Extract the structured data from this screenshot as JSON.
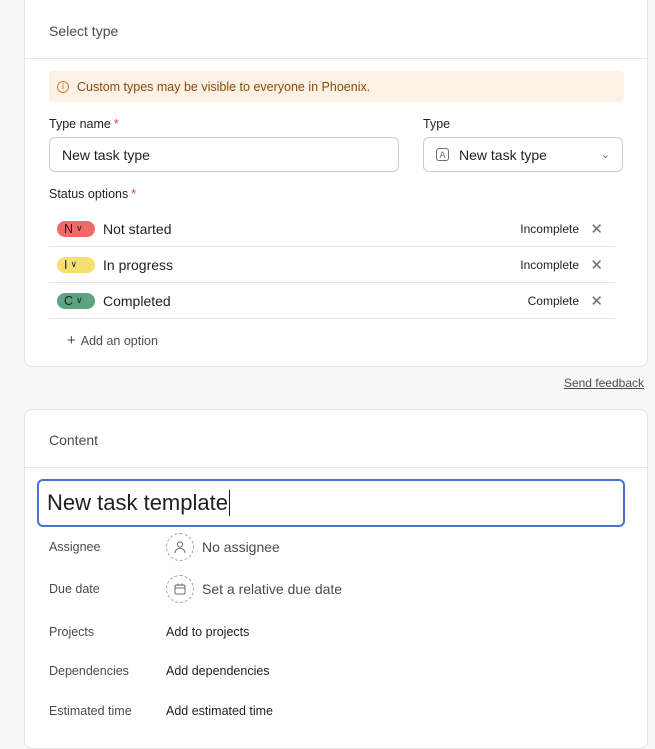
{
  "type_card": {
    "title": "Select type",
    "banner_text": "Custom types may be visible to everyone in Phoenix.",
    "type_name_label": "Type name",
    "required_mark": "*",
    "type_name_value": "New task type",
    "type_label": "Type",
    "type_select_value": "New task type",
    "status_options_label": "Status options",
    "status_options": [
      {
        "letter": "N",
        "name": "Not started",
        "state": "Incomplete",
        "color": "#f06a6a"
      },
      {
        "letter": "I",
        "name": "In progress",
        "state": "Incomplete",
        "color": "#f8df72"
      },
      {
        "letter": "C",
        "name": "Completed",
        "state": "Complete",
        "color": "#5da283"
      }
    ],
    "add_option_label": "Add an option"
  },
  "send_feedback": "Send feedback",
  "content_card": {
    "title": "Content",
    "task_title": "New task template",
    "fields": [
      {
        "label": "Assignee",
        "value": "No assignee"
      },
      {
        "label": "Due date",
        "value": "Set a relative due date"
      },
      {
        "label": "Projects",
        "value": "Add to projects"
      },
      {
        "label": "Dependencies",
        "value": "Add dependencies"
      },
      {
        "label": "Estimated time",
        "value": "Add estimated time"
      }
    ]
  },
  "colors": {
    "accent_focus": "#4573d2",
    "banner_bg": "#fdf1e6",
    "required": "#e8384f"
  },
  "icons": {
    "info": "info-circle-icon",
    "type": "letter-a-box-icon",
    "chevron": "chevron-down-icon",
    "remove": "close-icon",
    "add": "plus-icon",
    "assignee": "person-icon",
    "due_date": "calendar-icon"
  }
}
